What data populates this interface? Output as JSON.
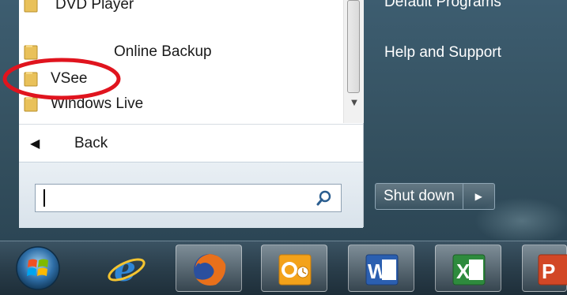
{
  "programs": {
    "items": [
      {
        "label": "DVD Player"
      },
      {
        "label": "Online Backup"
      },
      {
        "label": "VSee"
      },
      {
        "label": "Windows Live"
      }
    ],
    "back_label": "Back"
  },
  "search": {
    "placeholder": ""
  },
  "right_pane": {
    "items": [
      {
        "label": "Default Programs"
      },
      {
        "label": "Help and Support"
      }
    ],
    "shutdown_label": "Shut down"
  },
  "taskbar": {
    "apps": [
      {
        "name": "internet-explorer"
      },
      {
        "name": "firefox"
      },
      {
        "name": "outlook"
      },
      {
        "name": "word"
      },
      {
        "name": "excel"
      },
      {
        "name": "powerpoint"
      }
    ]
  },
  "colors": {
    "annotation": "#e0141e",
    "folder": "#e9c15a",
    "text_dark": "#1a1a1a",
    "right_text": "#ffffff"
  }
}
